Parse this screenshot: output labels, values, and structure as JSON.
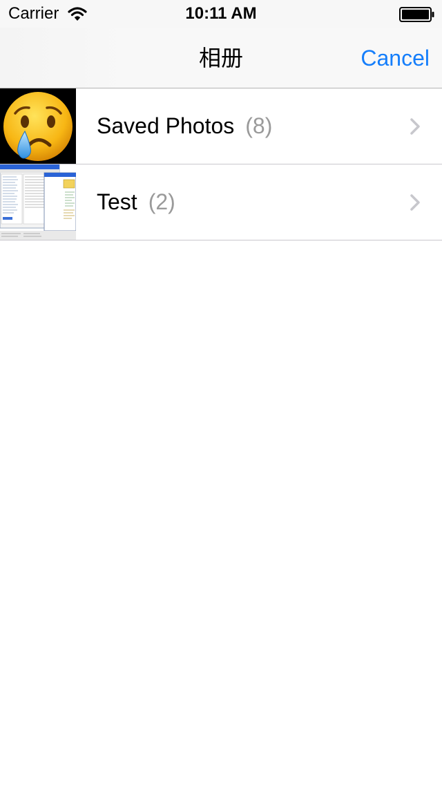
{
  "status_bar": {
    "carrier": "Carrier",
    "time": "10:11 AM",
    "icons": [
      "wifi-icon",
      "battery-icon"
    ]
  },
  "nav_bar": {
    "title": "相册",
    "cancel_label": "Cancel",
    "accent_color": "#157efb"
  },
  "albums": [
    {
      "name": "Saved Photos",
      "count": "(8)",
      "thumbnail": "crying-face-emoji"
    },
    {
      "name": "Test",
      "count": "(2)",
      "thumbnail": "file-manager-screenshot"
    }
  ],
  "count_color": "#9a9a9a"
}
